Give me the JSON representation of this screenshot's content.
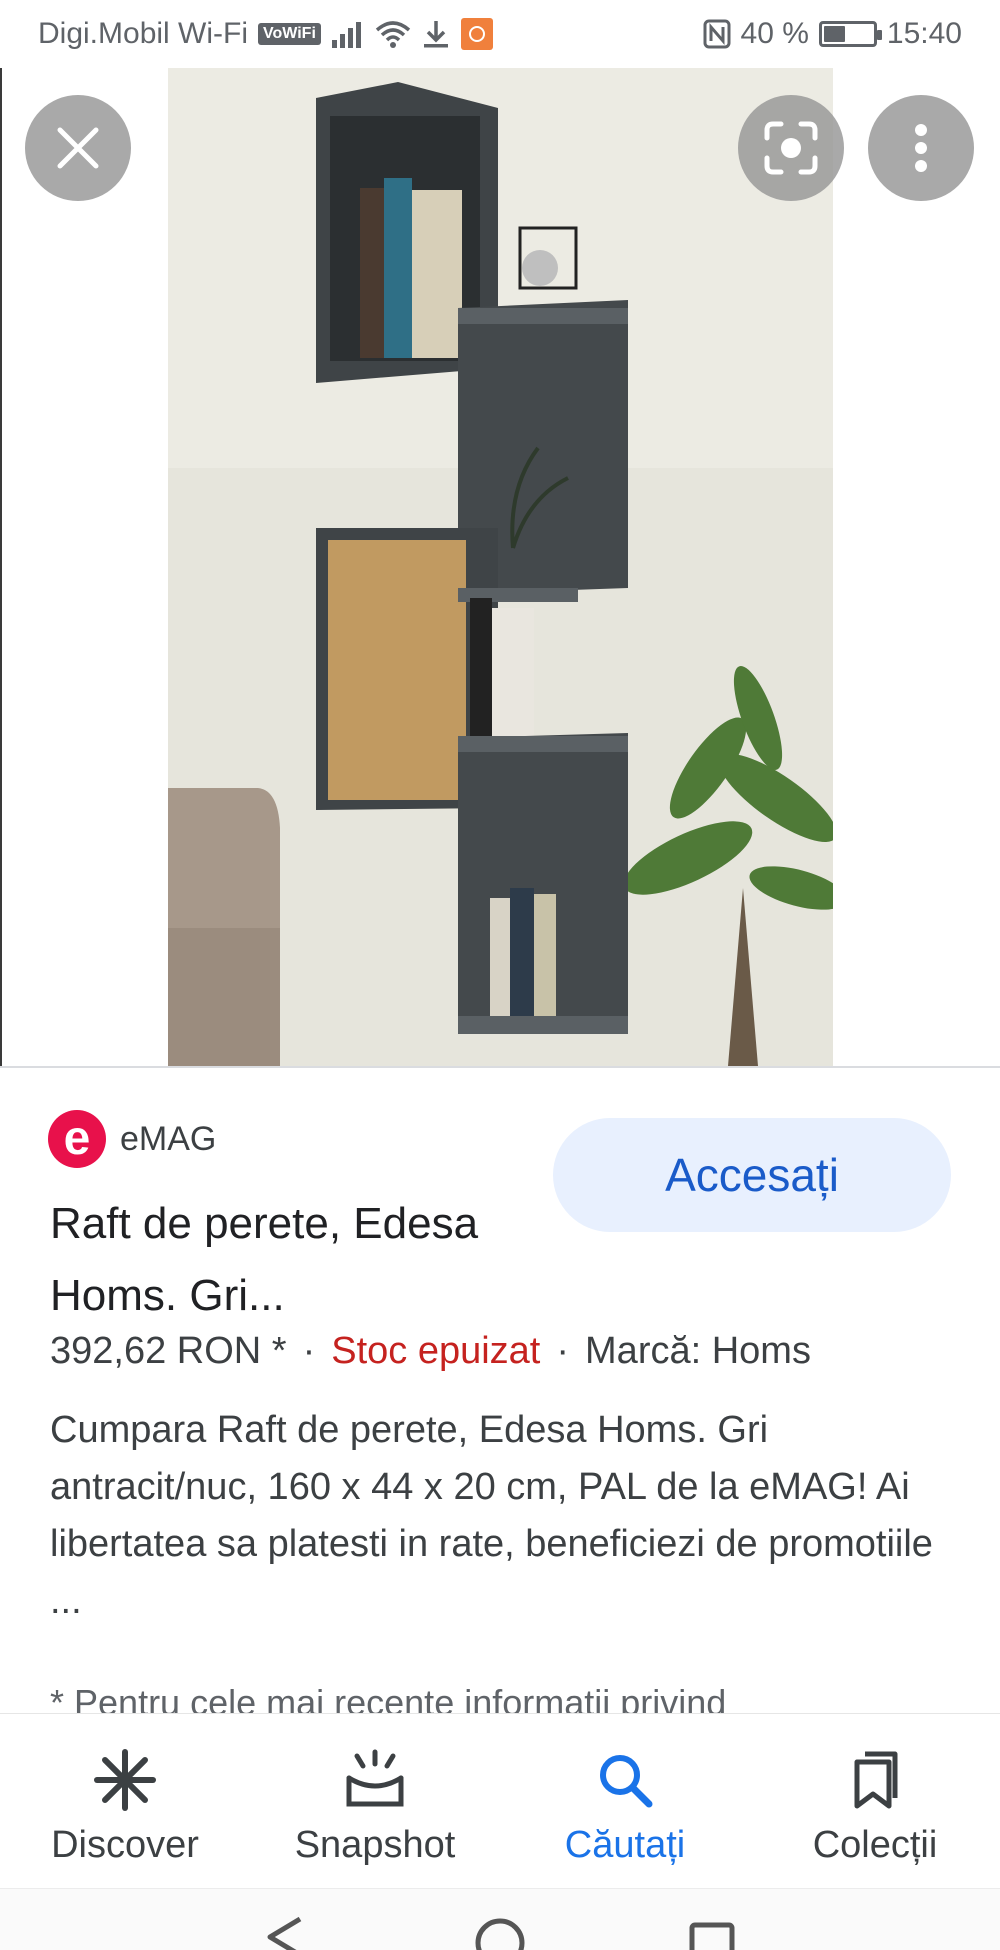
{
  "status_bar": {
    "carrier": "Digi.Mobil Wi-Fi",
    "vowifi_badge": "VoWiFi",
    "battery_percent": "40 %",
    "battery_level": 0.4,
    "time": "15:40"
  },
  "image_viewer": {
    "close_icon": "close-icon",
    "lens_icon": "lens-icon",
    "more_icon": "more-vert-icon"
  },
  "result": {
    "source_logo_letter": "e",
    "source_name": "eMAG",
    "visit_label": "Accesați",
    "title": "Raft de perete, Edesa Homs. Gri...",
    "price": "392,62 RON *",
    "dot1": "·",
    "stock": "Stoc epuizat",
    "dot2": "·",
    "brand": "Marcă: Homs",
    "description": "Cumpara Raft de perete, Edesa Homs. Gri antracit/nuc, 160 x 44 x 20 cm, PAL de la eMAG! Ai libertatea sa platesti in rate, beneficiezi de promotiile ...",
    "disclaimer": "* Pentru cele mai recente informatii privind"
  },
  "bottom_nav": {
    "items": [
      {
        "label": "Discover",
        "icon": "asterisk-icon"
      },
      {
        "label": "Snapshot",
        "icon": "snapshot-icon"
      },
      {
        "label": "Căutați",
        "icon": "search-icon"
      },
      {
        "label": "Colecții",
        "icon": "collections-icon"
      }
    ],
    "active_index": 2
  },
  "colors": {
    "accent": "#1a73e8",
    "stock_red": "#c5221f",
    "brand_emag": "#e8114b",
    "visit_button_bg": "#e8f0fe"
  }
}
